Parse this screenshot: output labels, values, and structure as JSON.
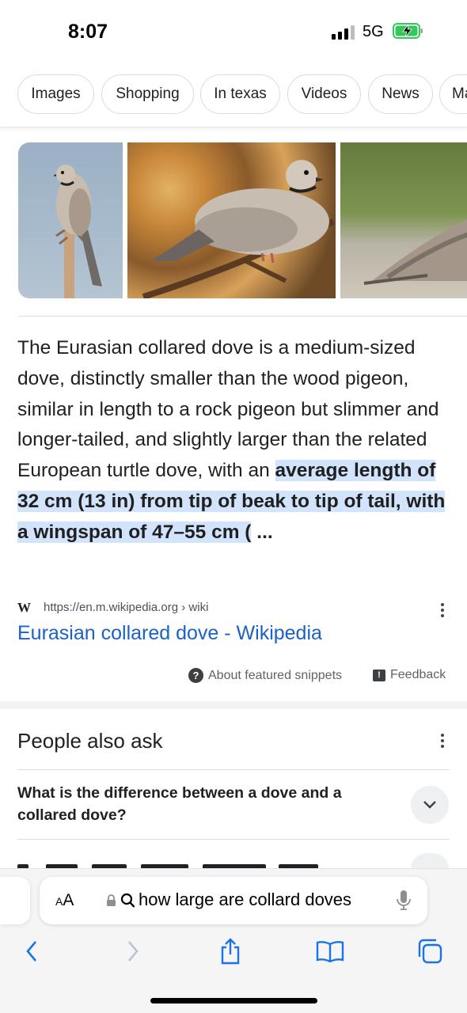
{
  "status_bar": {
    "time": "8:07",
    "network": "5G"
  },
  "chips": [
    "Images",
    "Shopping",
    "In texas",
    "Videos",
    "News",
    "Ma"
  ],
  "snippet": {
    "text_plain": "The Eurasian collared dove is a medium-sized dove, distinctly smaller than the wood pigeon, similar in length to a rock pigeon but slimmer and longer-tailed, and slightly larger than the related European turtle dove, with an ",
    "text_highlight": "average length of 32 cm (13 in) from tip of beak to tip of tail, with a wingspan of 47–55 cm (",
    "text_ellipsis": " ..."
  },
  "source": {
    "logo": "W",
    "url": "https://en.m.wikipedia.org › wiki",
    "title": "Eurasian collared dove - Wikipedia"
  },
  "featured": {
    "about": "About featured snippets",
    "feedback": "Feedback"
  },
  "people_also_ask": {
    "title": "People also ask",
    "questions": [
      "What is the difference between a dove and a collared dove?"
    ]
  },
  "browser": {
    "aa_small": "A",
    "aa_large": "A",
    "query": "how large are collard doves"
  }
}
